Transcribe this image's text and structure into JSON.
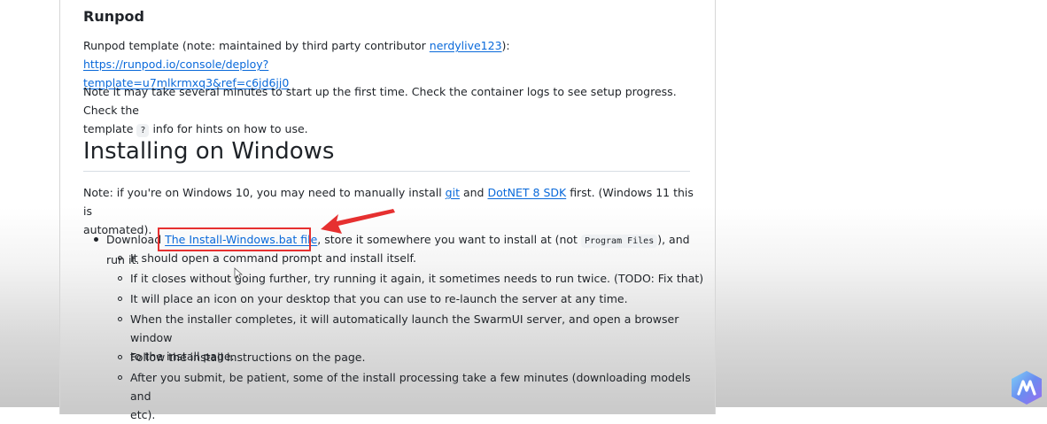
{
  "runpod": {
    "heading": "Runpod",
    "template_prefix": "Runpod template (note: maintained by third party contributor ",
    "contributor_link": "nerdylive123",
    "colon": "):",
    "url_line1": "https://runpod.io/console/deploy?",
    "url_line2": "template=u7mlkrmxq3&ref=c6jd6jj0",
    "note_line1": "Note it may take several minutes to start up the first time. Check the container logs to see setup progress. Check the",
    "note_line2_before": "template",
    "note_code": "?",
    "note_line2_after": "info for hints on how to use."
  },
  "windows": {
    "heading": "Installing on Windows",
    "note_prefix": "Note: if you're on Windows 10, you may need to manually install",
    "git_link": "git",
    "and": "and",
    "dotnet_link": "DotNET 8 SDK",
    "note_suffix": "first. (Windows 11 this is",
    "note_line2": "automated).",
    "download_prefix": "Download",
    "download_link": "The Install-Windows.bat file",
    "download_mid": ", store it somewhere you want to install at (not",
    "download_code": "Program Files",
    "download_suffix": "), and run it.",
    "sub_items": [
      "It should open a command prompt and install itself.",
      "If it closes without going further, try running it again, it sometimes needs to run twice. (TODO: Fix that)",
      "It will place an icon on your desktop that you can use to re-launch the server at any time.",
      "When the installer completes, it will automatically launch the SwarmUI server, and open a browser window",
      "Follow the install instructions on the page.",
      "After you submit, be patient, some of the install processing take a few minutes (downloading models and"
    ],
    "sub_item_4_cont": "to the install page.",
    "sub_item_6_cont": "etc)."
  },
  "colors": {
    "link": "#0969da",
    "highlight": "#e63030",
    "text": "#1f2328"
  },
  "badge_icon": "app-logo-icon"
}
